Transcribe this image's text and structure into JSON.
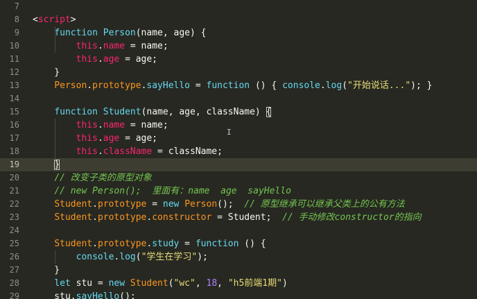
{
  "editor": {
    "language": "javascript",
    "theme_colors": {
      "background": "#272822",
      "active_line": "#3e3d32",
      "keyword": "#66d9ef",
      "this": "#f92672",
      "class_name": "#e6db74",
      "string": "#e6db74",
      "number": "#ae81ff",
      "comment": "#75c550"
    },
    "active_line_number": "19",
    "lines": [
      {
        "n": "7",
        "tokens": []
      },
      {
        "n": "8",
        "tokens": [
          {
            "t": "<",
            "c": "tk-plain"
          },
          {
            "t": "script",
            "c": "tk-this"
          },
          {
            "t": ">",
            "c": "tk-plain"
          }
        ]
      },
      {
        "n": "9",
        "tokens": [
          {
            "t": "    ",
            "c": "tk-plain"
          },
          {
            "t": "function",
            "c": "tk-kw"
          },
          {
            "t": " ",
            "c": "tk-plain"
          },
          {
            "t": "Person",
            "c": "tk-kw"
          },
          {
            "t": "(name, age) {",
            "c": "tk-plain"
          }
        ]
      },
      {
        "n": "10",
        "tokens": [
          {
            "t": "        ",
            "c": "tk-plain"
          },
          {
            "t": "this",
            "c": "tk-this"
          },
          {
            "t": ".",
            "c": "tk-plain"
          },
          {
            "t": "name",
            "c": "tk-this"
          },
          {
            "t": " = name;",
            "c": "tk-plain"
          }
        ]
      },
      {
        "n": "11",
        "tokens": [
          {
            "t": "        ",
            "c": "tk-plain"
          },
          {
            "t": "this",
            "c": "tk-this"
          },
          {
            "t": ".",
            "c": "tk-plain"
          },
          {
            "t": "age",
            "c": "tk-this"
          },
          {
            "t": " = age;",
            "c": "tk-plain"
          }
        ]
      },
      {
        "n": "12",
        "tokens": [
          {
            "t": "    }",
            "c": "tk-plain"
          }
        ]
      },
      {
        "n": "13",
        "tokens": [
          {
            "t": "    ",
            "c": "tk-plain"
          },
          {
            "t": "Person",
            "c": "tk-ident"
          },
          {
            "t": ".",
            "c": "tk-plain"
          },
          {
            "t": "prototype",
            "c": "tk-ident"
          },
          {
            "t": ".",
            "c": "tk-plain"
          },
          {
            "t": "sayHello",
            "c": "tk-kw"
          },
          {
            "t": " = ",
            "c": "tk-plain"
          },
          {
            "t": "function",
            "c": "tk-kw"
          },
          {
            "t": " () { ",
            "c": "tk-plain"
          },
          {
            "t": "console",
            "c": "tk-kw"
          },
          {
            "t": ".",
            "c": "tk-plain"
          },
          {
            "t": "log",
            "c": "tk-kw"
          },
          {
            "t": "(",
            "c": "tk-plain"
          },
          {
            "t": "\"开始说话...\"",
            "c": "tk-str"
          },
          {
            "t": "); }",
            "c": "tk-plain"
          }
        ]
      },
      {
        "n": "14",
        "tokens": []
      },
      {
        "n": "15",
        "tokens": [
          {
            "t": "    ",
            "c": "tk-plain"
          },
          {
            "t": "function",
            "c": "tk-kw"
          },
          {
            "t": " ",
            "c": "tk-plain"
          },
          {
            "t": "Student",
            "c": "tk-kw"
          },
          {
            "t": "(name, age, className) ",
            "c": "tk-plain"
          },
          {
            "t": "{",
            "c": "tk-brace-hl"
          }
        ]
      },
      {
        "n": "16",
        "tokens": [
          {
            "t": "        ",
            "c": "tk-plain"
          },
          {
            "t": "this",
            "c": "tk-this"
          },
          {
            "t": ".",
            "c": "tk-plain"
          },
          {
            "t": "name",
            "c": "tk-this"
          },
          {
            "t": " = name;",
            "c": "tk-plain"
          }
        ]
      },
      {
        "n": "17",
        "tokens": [
          {
            "t": "        ",
            "c": "tk-plain"
          },
          {
            "t": "this",
            "c": "tk-this"
          },
          {
            "t": ".",
            "c": "tk-plain"
          },
          {
            "t": "age",
            "c": "tk-this"
          },
          {
            "t": " = age;",
            "c": "tk-plain"
          }
        ]
      },
      {
        "n": "18",
        "tokens": [
          {
            "t": "        ",
            "c": "tk-plain"
          },
          {
            "t": "this",
            "c": "tk-this"
          },
          {
            "t": ".",
            "c": "tk-plain"
          },
          {
            "t": "className",
            "c": "tk-this"
          },
          {
            "t": " = className;",
            "c": "tk-plain"
          }
        ]
      },
      {
        "n": "19",
        "tokens": [
          {
            "t": "    ",
            "c": "tk-plain"
          },
          {
            "t": "}",
            "c": "tk-brace-hl"
          }
        ]
      },
      {
        "n": "20",
        "tokens": [
          {
            "t": "    ",
            "c": "tk-plain"
          },
          {
            "t": "// 改变子类的原型对象",
            "c": "tk-comment"
          }
        ]
      },
      {
        "n": "21",
        "tokens": [
          {
            "t": "    ",
            "c": "tk-plain"
          },
          {
            "t": "// new Person();  里面有：name  age  sayHello",
            "c": "tk-comment"
          }
        ]
      },
      {
        "n": "22",
        "tokens": [
          {
            "t": "    ",
            "c": "tk-plain"
          },
          {
            "t": "Student",
            "c": "tk-ident"
          },
          {
            "t": ".",
            "c": "tk-plain"
          },
          {
            "t": "prototype",
            "c": "tk-ident"
          },
          {
            "t": " = ",
            "c": "tk-plain"
          },
          {
            "t": "new",
            "c": "tk-kw"
          },
          {
            "t": " ",
            "c": "tk-plain"
          },
          {
            "t": "Person",
            "c": "tk-ident"
          },
          {
            "t": "();  ",
            "c": "tk-plain"
          },
          {
            "t": "// 原型继承可以继承父类上的公有方法",
            "c": "tk-comment"
          }
        ]
      },
      {
        "n": "23",
        "tokens": [
          {
            "t": "    ",
            "c": "tk-plain"
          },
          {
            "t": "Student",
            "c": "tk-ident"
          },
          {
            "t": ".",
            "c": "tk-plain"
          },
          {
            "t": "prototype",
            "c": "tk-ident"
          },
          {
            "t": ".",
            "c": "tk-plain"
          },
          {
            "t": "constructor",
            "c": "tk-ident"
          },
          {
            "t": " = Student;  ",
            "c": "tk-plain"
          },
          {
            "t": "// 手动修改constructor的指向",
            "c": "tk-comment"
          }
        ]
      },
      {
        "n": "24",
        "tokens": []
      },
      {
        "n": "25",
        "tokens": [
          {
            "t": "    ",
            "c": "tk-plain"
          },
          {
            "t": "Student",
            "c": "tk-ident"
          },
          {
            "t": ".",
            "c": "tk-plain"
          },
          {
            "t": "prototype",
            "c": "tk-ident"
          },
          {
            "t": ".",
            "c": "tk-plain"
          },
          {
            "t": "study",
            "c": "tk-kw"
          },
          {
            "t": " = ",
            "c": "tk-plain"
          },
          {
            "t": "function",
            "c": "tk-kw"
          },
          {
            "t": " () {",
            "c": "tk-plain"
          }
        ]
      },
      {
        "n": "26",
        "tokens": [
          {
            "t": "        ",
            "c": "tk-plain"
          },
          {
            "t": "console",
            "c": "tk-kw"
          },
          {
            "t": ".",
            "c": "tk-plain"
          },
          {
            "t": "log",
            "c": "tk-kw"
          },
          {
            "t": "(",
            "c": "tk-plain"
          },
          {
            "t": "\"学生在学习\"",
            "c": "tk-str"
          },
          {
            "t": ");",
            "c": "tk-plain"
          }
        ]
      },
      {
        "n": "27",
        "tokens": [
          {
            "t": "    }",
            "c": "tk-plain"
          }
        ]
      },
      {
        "n": "28",
        "tokens": [
          {
            "t": "    ",
            "c": "tk-plain"
          },
          {
            "t": "let",
            "c": "tk-kw"
          },
          {
            "t": " stu = ",
            "c": "tk-plain"
          },
          {
            "t": "new",
            "c": "tk-kw"
          },
          {
            "t": " ",
            "c": "tk-plain"
          },
          {
            "t": "Student",
            "c": "tk-ident"
          },
          {
            "t": "(",
            "c": "tk-plain"
          },
          {
            "t": "\"wc\"",
            "c": "tk-str"
          },
          {
            "t": ", ",
            "c": "tk-plain"
          },
          {
            "t": "18",
            "c": "tk-num"
          },
          {
            "t": ", ",
            "c": "tk-plain"
          },
          {
            "t": "\"h5前端1期\"",
            "c": "tk-str"
          },
          {
            "t": ")",
            "c": "tk-plain"
          }
        ]
      },
      {
        "n": "29",
        "tokens": [
          {
            "t": "    stu.",
            "c": "tk-plain"
          },
          {
            "t": "sayHello",
            "c": "tk-kw"
          },
          {
            "t": "();",
            "c": "tk-plain"
          }
        ]
      }
    ]
  },
  "mouse_cursor": {
    "icon": "ibeam-cursor-icon",
    "glyph": "I"
  }
}
